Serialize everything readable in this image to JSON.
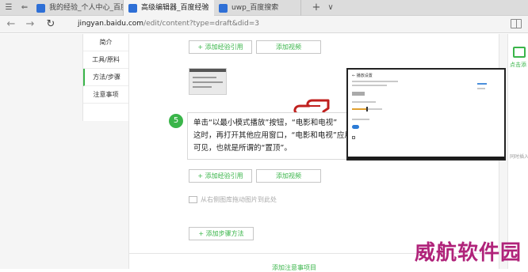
{
  "tabs": [
    {
      "label": "我的经验_个人中心_百度经验",
      "active": false
    },
    {
      "label": "高级编辑器_百度经验",
      "active": true
    },
    {
      "label": "uwp_百度搜索",
      "active": false
    }
  ],
  "new_tab_label": "+",
  "tab_menu_label": "∨",
  "address": {
    "domain": "jingyan.baidu.com",
    "path": "/edit/content?type=draft&did=3"
  },
  "leftnav": [
    "简介",
    "工具/原料",
    "方法/步骤",
    "注意事项"
  ],
  "buttons": {
    "add_reference_1": "+ 添加经验引用",
    "add_video_1": "添加视频",
    "add_reference_2": "+ 添加经验引用",
    "add_video_2": "添加视频",
    "add_step": "+ 添加步骤方法",
    "bottom": "添加注意事项目"
  },
  "step": {
    "number": "5",
    "lines": [
      "单击“以最小模式播放”按钮，“电影和电视”",
      "这时，再打开其他应用窗口，“电影和电视”应用窗口仍然在桌面的最顶层保持",
      "可见，也就是所谓的“置顶”。"
    ]
  },
  "tools": {
    "close": "×",
    "add": "+"
  },
  "image_placeholder": "从右侧图库拖动图片到此处",
  "rail": {
    "label": "点击添",
    "note": "同时插入"
  },
  "preview": {
    "title": "← 播放设置"
  },
  "watermark": "威航软件园",
  "colors": {
    "brand_green": "#3ab54a",
    "watermark": "#b0237a",
    "hand": "#c0201e"
  }
}
